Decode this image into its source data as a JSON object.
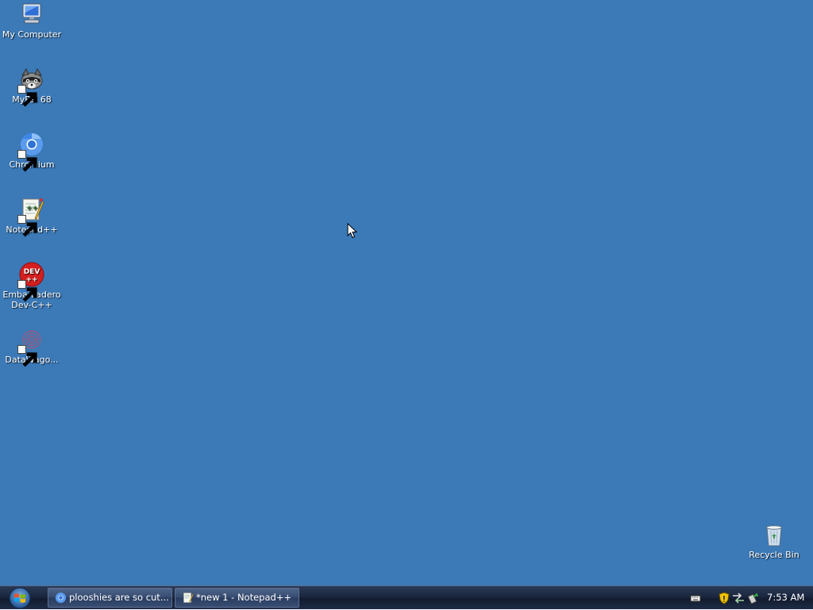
{
  "desktop": {
    "background_color": "#3b79b7",
    "icons": [
      {
        "label": "My Computer",
        "icon": "computer-icon",
        "shortcut": false
      },
      {
        "label": "MyPal 68",
        "icon": "raccoon-icon",
        "shortcut": true
      },
      {
        "label": "Chromium",
        "icon": "chromium-icon",
        "shortcut": true
      },
      {
        "label": "Notepad++",
        "icon": "notepadpp-icon",
        "shortcut": true
      },
      {
        "label": "Embarcadero\nDev-C++",
        "icon": "devcpp-icon",
        "shortcut": true
      },
      {
        "label": "DataWago...",
        "icon": "datawagon-icon",
        "shortcut": true
      }
    ],
    "recycle_bin": {
      "label": "Recycle Bin",
      "icon": "recycle-bin-icon"
    }
  },
  "taskbar": {
    "start_icon": "windows-logo-icon",
    "tasks": [
      {
        "label": "plooshies are so cut...",
        "icon": "chromium-icon"
      },
      {
        "label": "*new 1 - Notepad++",
        "icon": "notepadpp-icon"
      }
    ],
    "tray": {
      "icons": [
        "keyboard-icon",
        "security-shield-icon",
        "network-icon",
        "safely-remove-icon"
      ],
      "clock": "7:53 AM"
    }
  }
}
